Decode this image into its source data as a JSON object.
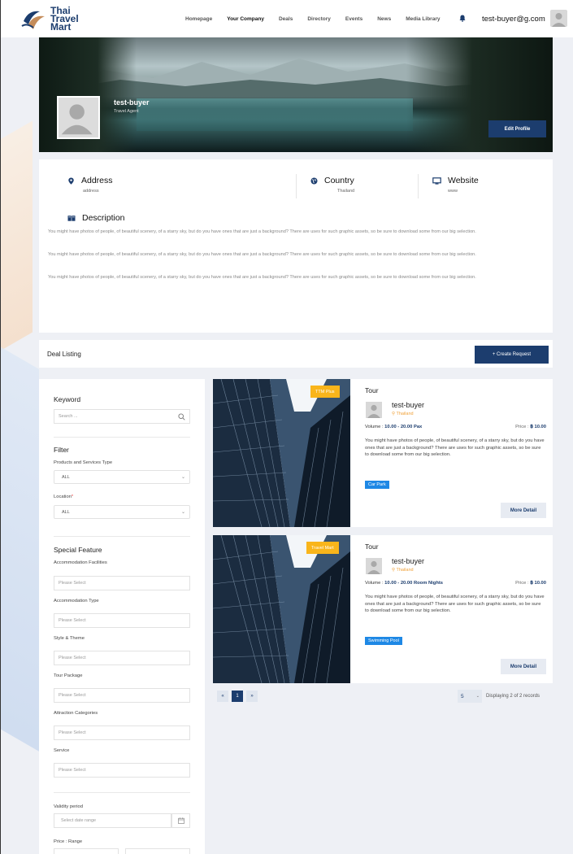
{
  "brand": {
    "line1": "Thai",
    "line2": "Travel",
    "line3": "Mart"
  },
  "nav": [
    {
      "label": "Homepage",
      "active": false
    },
    {
      "label": "Your Company",
      "active": true
    },
    {
      "label": "Deals",
      "active": false
    },
    {
      "label": "Directory",
      "active": false
    },
    {
      "label": "Events",
      "active": false
    },
    {
      "label": "News",
      "active": false
    },
    {
      "label": "Media Library",
      "active": false
    }
  ],
  "user": {
    "email": "test-buyer@g.com",
    "bell_icon": "bell-icon"
  },
  "profile": {
    "name": "test-buyer",
    "role": "Travel Agent",
    "edit_label": "Edit Profile"
  },
  "info": {
    "address_title": "Address",
    "address_value": "address",
    "country_title": "Country",
    "country_value": "Thailand",
    "website_title": "Website",
    "website_value": "www",
    "description_title": "Description",
    "description_paragraphs": [
      "You might have photos of people, of beautiful scenery, of a starry sky, but do you have ones that are just a background? There are uses for such graphic assets, so be sure to download some from our big selection.",
      "You might have photos of people, of beautiful scenery, of a starry sky, but do you have ones that are just a background? There are uses for such graphic assets, so be sure to download some from our big selection.",
      "You might have photos of people, of beautiful scenery, of a starry sky, but do you have ones that are just a background? There are uses for such graphic assets, so be sure to download some from our big selection."
    ]
  },
  "deal_listing": {
    "title": "Deal Listing",
    "create_label": "+ Create Request"
  },
  "filters": {
    "keyword_title": "Keyword",
    "search_placeholder": "Search ...",
    "filter_title": "Filter",
    "products_label": "Products and Services Type",
    "products_value": "ALL",
    "location_label": "Location",
    "location_value": "ALL",
    "special_title": "Special Feature",
    "fields": [
      {
        "label": "Accommodation Facilities",
        "placeholder": "Please Select"
      },
      {
        "label": "Accommodation Type",
        "placeholder": "Please Select"
      },
      {
        "label": "Style & Theme",
        "placeholder": "Please Select"
      },
      {
        "label": "Tour Package",
        "placeholder": "Please Select"
      },
      {
        "label": "Attraction Categories",
        "placeholder": "Please Select"
      },
      {
        "label": "Service",
        "placeholder": "Please Select"
      }
    ],
    "validity_label": "Validity period",
    "date_placeholder": "Select date range",
    "price_label": "Price : Range"
  },
  "deals": [
    {
      "badge": "TTM Plus",
      "type": "Tour",
      "seller": "test-buyer",
      "location": "Thailand",
      "volume_label": "Volume : ",
      "volume_value": "10.00 - 20.00 Pax",
      "price_label": "Price : ",
      "price_value": "฿ 10.00",
      "text": "You might have photos of people, of beautiful scenery, of a starry sky, but do you have ones that are just a background? There are uses for such graphic assets, so be sure to download some from our big selection.",
      "tag": "Car Park",
      "more_label": "More Detail"
    },
    {
      "badge": "Travel Mart",
      "type": "Tour",
      "seller": "test-buyer",
      "location": "Thailand",
      "volume_label": "Volume : ",
      "volume_value": "10.00 - 20.00 Room Nights",
      "price_label": "Price : ",
      "price_value": "฿ 10.00",
      "text": "You might have photos of people, of beautiful scenery, of a starry sky, but do you have ones that are just a background? There are uses for such graphic assets, so be sure to download some from our big selection.",
      "tag": "Swimming Pool",
      "more_label": "More Detail"
    }
  ],
  "pagination": {
    "first": "«",
    "current": "1",
    "last": "»",
    "per_page": "5",
    "summary": "Displaying 2 of 2 records"
  },
  "colors": {
    "primary": "#1c3d6e",
    "badge": "#f9b51b",
    "tag": "#1e88e5",
    "location": "#f0a23b"
  }
}
